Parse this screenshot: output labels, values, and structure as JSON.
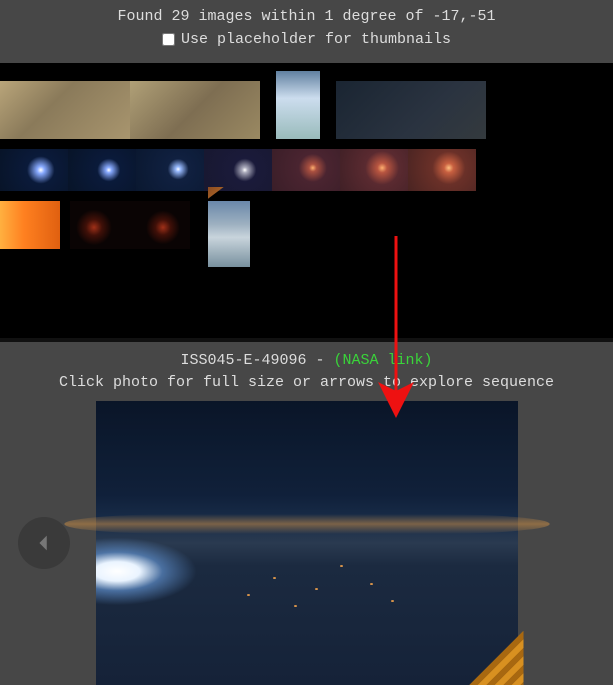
{
  "header": {
    "found_text": "Found 29 images within 1 degree of -17,-51",
    "checkbox_label": "Use placeholder for thumbnails",
    "checkbox_checked": false
  },
  "viewer": {
    "photo_id": "ISS045-E-49096",
    "separator": " - ",
    "nasa_link_text": "(NASA link)",
    "instruction": "Click photo for full size or arrows to explore sequence"
  }
}
